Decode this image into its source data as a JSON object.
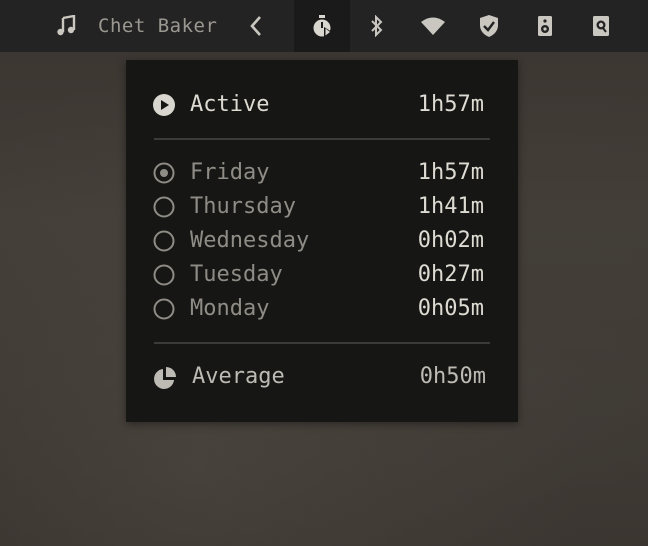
{
  "topbar": {
    "track_title": "Chet Baker",
    "icons": [
      "music-icon",
      "chevron-left-icon",
      "stopwatch-icon",
      "bluetooth-icon",
      "wifi-icon",
      "vpn-shield-icon",
      "speaker-icon",
      "sound-card-icon"
    ]
  },
  "popup": {
    "active": {
      "label": "Active",
      "value": "1h57m"
    },
    "days": [
      {
        "label": "Friday",
        "value": "1h57m",
        "selected": true
      },
      {
        "label": "Thursday",
        "value": "1h41m",
        "selected": false
      },
      {
        "label": "Wednesday",
        "value": "0h02m",
        "selected": false
      },
      {
        "label": "Tuesday",
        "value": "0h27m",
        "selected": false
      },
      {
        "label": "Monday",
        "value": "0h05m",
        "selected": false
      }
    ],
    "average": {
      "label": "Average",
      "value": "0h50m"
    }
  },
  "colors": {
    "bar_bg": "#232323",
    "popup_bg": "#161615",
    "icon": "#c9c7c0"
  }
}
